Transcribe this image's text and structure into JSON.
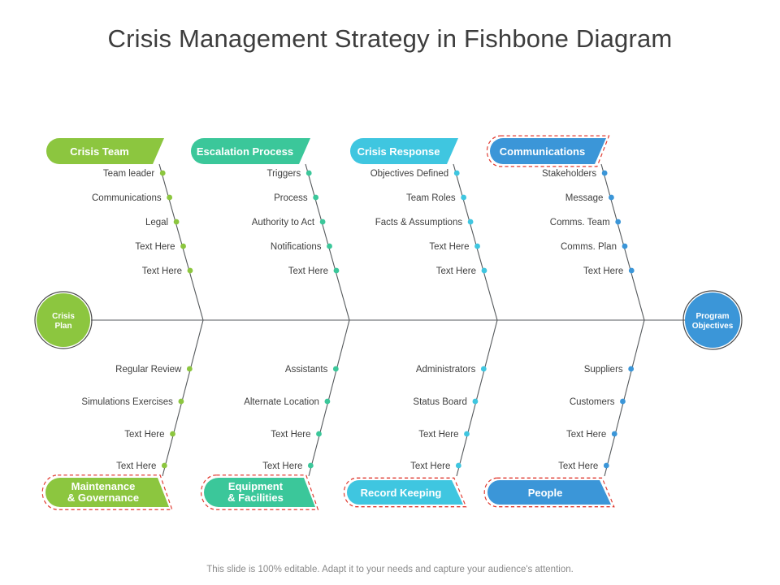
{
  "slide": {
    "title": "Crisis Management Strategy in Fishbone Diagram",
    "footer": "This slide is 100% editable. Adapt it to your needs and capture your audience's attention."
  },
  "colors": {
    "green": "#8CC63F",
    "teal": "#3BC79A",
    "cyan": "#3FC6E0",
    "blue": "#3B96D8",
    "line": "#55595c",
    "selection": "#e03a30",
    "title": "#3d3d3d",
    "item_text": "#3f3f3f",
    "footer_text": "#8a8a8a"
  },
  "head_left": {
    "line1": "Crisis",
    "line2": "Plan",
    "color": "#8CC63F"
  },
  "head_right": {
    "line1": "Program",
    "line2": "Objectives",
    "color": "#3B96D8"
  },
  "categories_top": [
    {
      "label": "Crisis Team",
      "label_line2": "",
      "color": "#8CC63F",
      "selected": false,
      "items": [
        "Team leader",
        "Communications",
        "Legal",
        "Text Here",
        "Text Here"
      ]
    },
    {
      "label": "Escalation Process",
      "label_line2": "",
      "color": "#3BC79A",
      "selected": false,
      "items": [
        "Triggers",
        "Process",
        "Authority to Act",
        "Notifications",
        "Text Here"
      ]
    },
    {
      "label": "Crisis Response",
      "label_line2": "",
      "color": "#3FC6E0",
      "selected": false,
      "items": [
        "Objectives Defined",
        "Team Roles",
        "Facts & Assumptions",
        "Text Here",
        "Text Here"
      ]
    },
    {
      "label": "Communications",
      "label_line2": "",
      "color": "#3B96D8",
      "selected": true,
      "items": [
        "Stakeholders",
        "Message",
        "Comms. Team",
        "Comms. Plan",
        "Text Here"
      ]
    }
  ],
  "categories_bottom": [
    {
      "label": "Maintenance",
      "label_line2": "& Governance",
      "color": "#8CC63F",
      "selected": true,
      "items": [
        "Regular Review",
        "Simulations Exercises",
        "Text Here",
        "Text Here"
      ]
    },
    {
      "label": "Equipment",
      "label_line2": "& Facilities",
      "color": "#3BC79A",
      "selected": true,
      "items": [
        "Assistants",
        "Alternate Location",
        "Text Here",
        "Text Here"
      ]
    },
    {
      "label": "Record Keeping",
      "label_line2": "",
      "color": "#3FC6E0",
      "selected": true,
      "items": [
        "Administrators",
        "Status Board",
        "Text Here",
        "Text Here"
      ]
    },
    {
      "label": "People",
      "label_line2": "",
      "color": "#3B96D8",
      "selected": true,
      "items": [
        "Suppliers",
        "Customers",
        "Text Here",
        "Text Here"
      ]
    }
  ]
}
